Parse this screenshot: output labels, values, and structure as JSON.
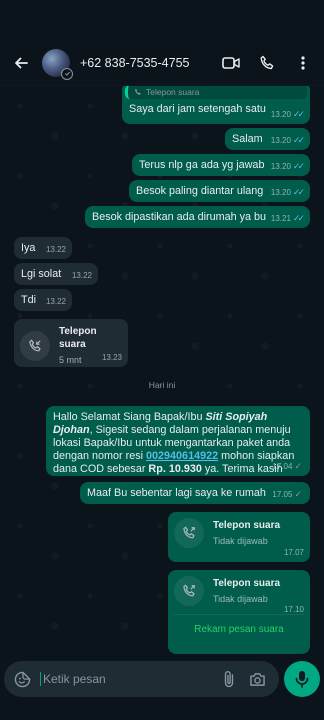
{
  "header": {
    "contact_name": "+62 838-7535-4755"
  },
  "composer": {
    "placeholder": "Ketik pesan"
  },
  "messages_before": [
    {
      "quote": "Telepon suara",
      "text": "Saya dari jam setengah satu",
      "time": "13.20"
    },
    {
      "text": "Salam",
      "time": "13.20"
    },
    {
      "text": "Terus nlp ga ada yg jawab",
      "time": "13.20"
    },
    {
      "text": "Besok paling diantar ulang",
      "time": "13.20"
    },
    {
      "text": "Besok dipastikan ada dirumah ya bu",
      "time": "13.21"
    }
  ],
  "incoming": [
    {
      "text": "Iya",
      "time": "13.22"
    },
    {
      "text": "Lgi solat",
      "time": "13.22"
    },
    {
      "text": "Tdi",
      "time": "13.22"
    }
  ],
  "incoming_call": {
    "title": "Telepon suara",
    "subtitle": "5 mnt",
    "time": "13.23"
  },
  "day_separator": "Hari ini",
  "long_message": {
    "part1": "Hallo Selamat Siang Bapak/Ibu ",
    "name": "Siti Sopiyah Djohan",
    "part2": ", Sigesit sedang dalam perjalanan menuju lokasi Bapak/Ibu untuk mengantarkan paket anda dengan nomor resi ",
    "resi": "002940614922",
    "part3": " mohon siapkan dana COD sebesar ",
    "amount": "Rp. 10.930",
    "part4": " ya. Terima kasih",
    "time": "17.04"
  },
  "short_message": {
    "text": "Maaf Bu sebentar lagi saya ke rumah",
    "time": "17.05"
  },
  "outgoing_calls": [
    {
      "title": "Telepon suara",
      "subtitle": "Tidak dijawab",
      "time": "17.07"
    },
    {
      "title": "Telepon suara",
      "subtitle": "Tidak dijawab",
      "time": "17.10",
      "action": "Rekam pesan suara"
    }
  ],
  "colors": {
    "background": "#0b141a",
    "outgoing_bubble": "#005c4b",
    "incoming_bubble": "#202c33",
    "read_tick": "#53bdeb",
    "accent": "#00a884"
  }
}
